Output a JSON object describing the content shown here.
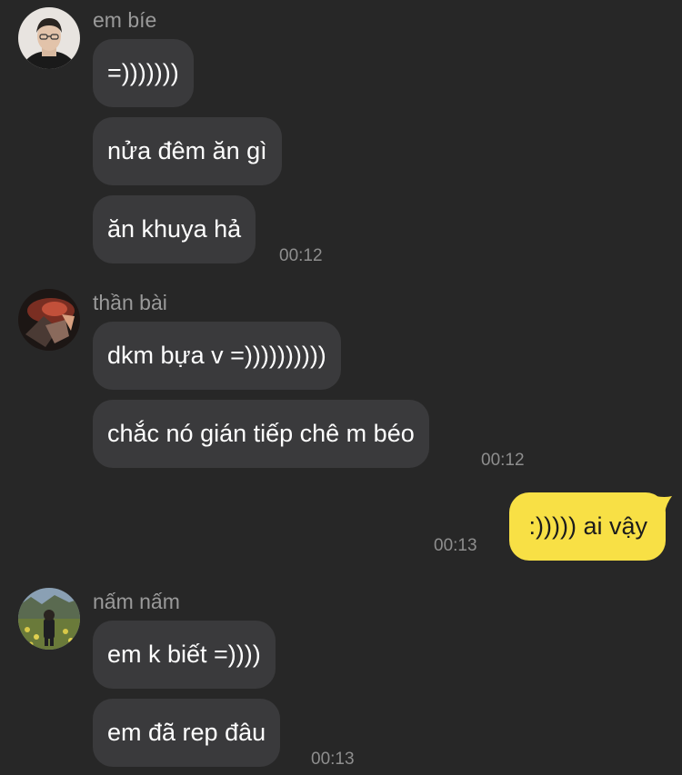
{
  "groups": [
    {
      "sender": "em bíe",
      "avatar_icon": "avatar-person-with-glasses-icon",
      "messages": [
        "=)))))))",
        "nửa đêm ăn gì",
        "ăn khuya hả"
      ],
      "time": "00:12"
    },
    {
      "sender": "thần bài",
      "avatar_icon": "avatar-dark-orange-photo-icon",
      "messages": [
        "dkm bựa v =))))))))))",
        "chắc nó gián tiếp chê m béo"
      ],
      "time": "00:12"
    },
    {
      "sender": "nấm nấm",
      "avatar_icon": "avatar-person-in-field-icon",
      "messages": [
        "em k biết =))))",
        "em đã rep đâu"
      ],
      "time": "00:13"
    }
  ],
  "outgoing": {
    "text": ":))))) ai vậy",
    "time": "00:13",
    "bubble_color": "#f8e045"
  },
  "colors": {
    "background": "#272727",
    "incoming_bubble": "#3a3a3c",
    "sender_text": "#9a9a9a",
    "timestamp": "#8e8e8e"
  }
}
